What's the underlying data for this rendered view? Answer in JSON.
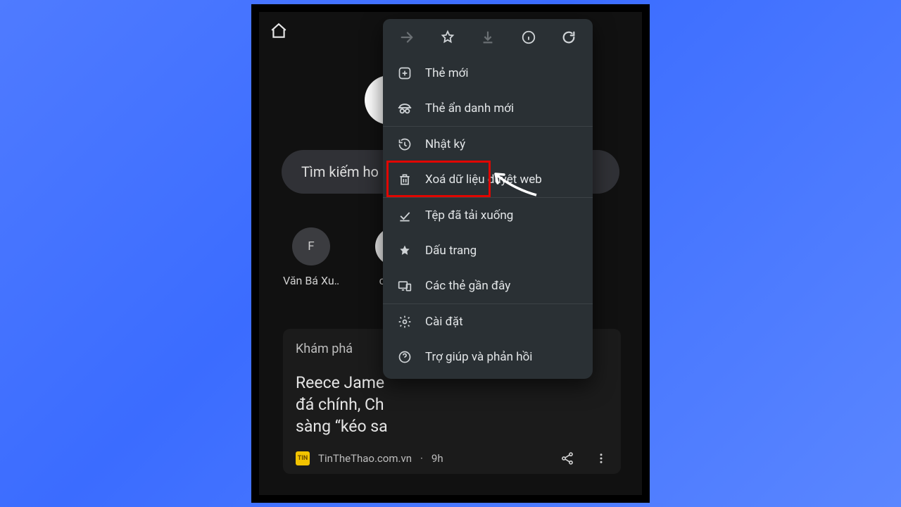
{
  "search_placeholder": "Tìm kiếm ho",
  "tiles": [
    {
      "badge": "F",
      "label": "Văn Bá Xu…"
    },
    {
      "badge": "",
      "label": "cache"
    }
  ],
  "discover": {
    "header": "Khám phá",
    "title": "Reece Jame\nđá chính, Ch\nsàng “kéo sa",
    "source": "TinTheThao.com.vn",
    "time": "9h"
  },
  "menu": {
    "new_tab": "Thẻ mới",
    "incognito": "Thẻ ẩn danh mới",
    "history": "Nhật ký",
    "clear": "Xoá dữ liệu duyệt web",
    "downloads": "Tệp đã tải xuống",
    "bookmarks": "Dấu trang",
    "recent_tabs": "Các thẻ gần đây",
    "settings": "Cài đặt",
    "help": "Trợ giúp và phản hồi"
  }
}
